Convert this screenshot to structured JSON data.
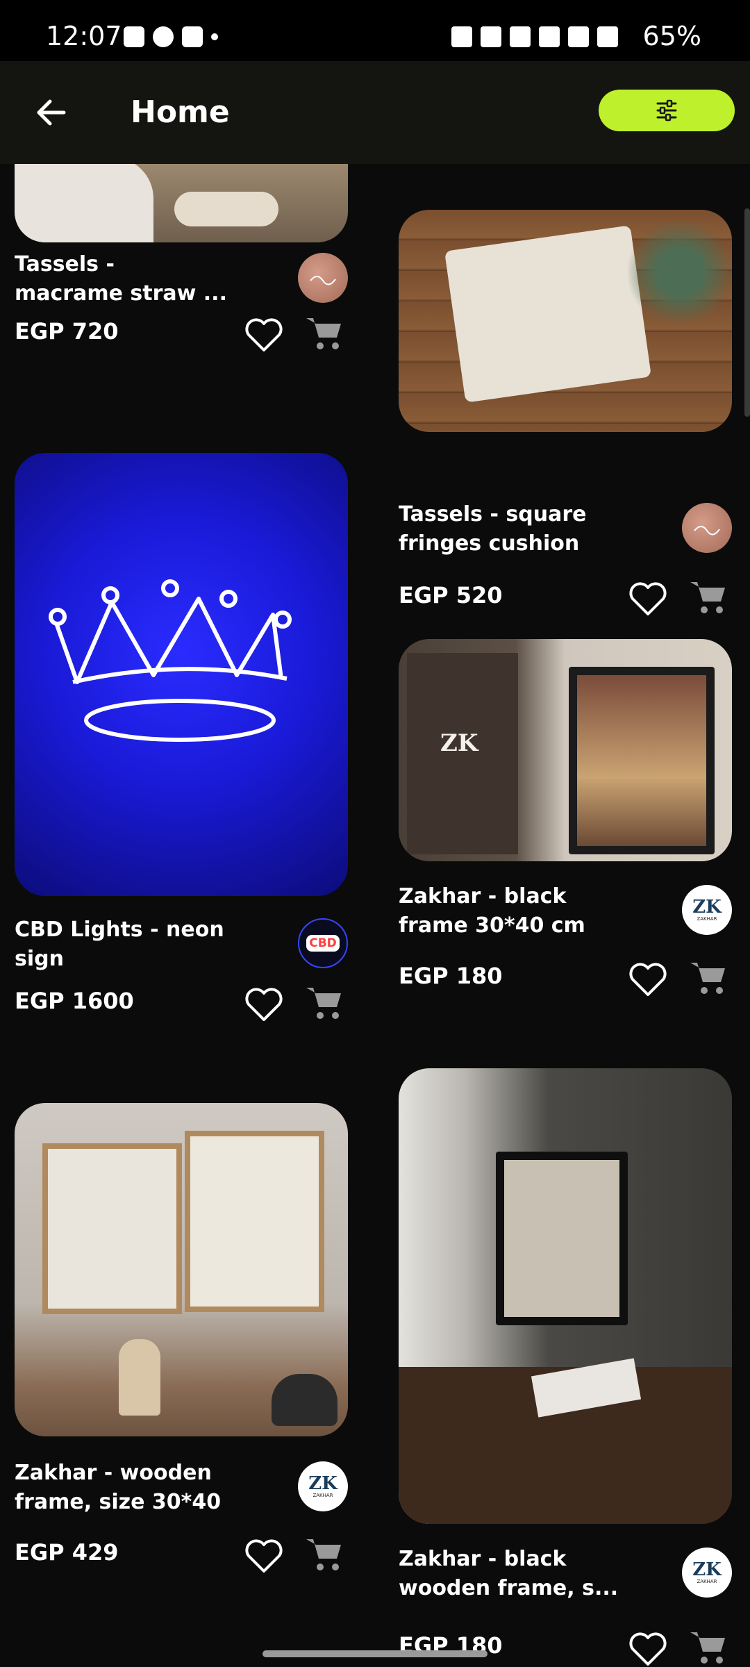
{
  "status_bar": {
    "time": "12:07",
    "battery": "65%"
  },
  "app_bar": {
    "title": "Home"
  },
  "products": [
    {
      "name": "Tassels -\nmacrame straw ...",
      "price": "EGP 720",
      "vendor_icon": "tassels-logo"
    },
    {
      "name": "Tassels - square\nfringes cushion",
      "price": "EGP 520",
      "vendor_icon": "tassels-logo"
    },
    {
      "name": "CBD Lights - neon\nsign",
      "price": "EGP 1600",
      "vendor_icon": "cbd-logo"
    },
    {
      "name": "Zakhar - black\nframe 30*40 cm",
      "price": "EGP 180",
      "vendor_icon": "zakhar-logo"
    },
    {
      "name": "Zakhar - wooden\nframe, size 30*40",
      "price": "EGP 429",
      "vendor_icon": "zakhar-logo"
    },
    {
      "name": "Zakhar - black\nwooden frame, s...",
      "price": "EGP 180",
      "vendor_icon": "zakhar-logo"
    }
  ],
  "logos": {
    "zakhar_text": "ZK",
    "zakhar_sub": "ZAKHAR",
    "cbd_text": "CBD"
  },
  "colors": {
    "accent": "#bef02c",
    "background": "#0b0b0b"
  }
}
